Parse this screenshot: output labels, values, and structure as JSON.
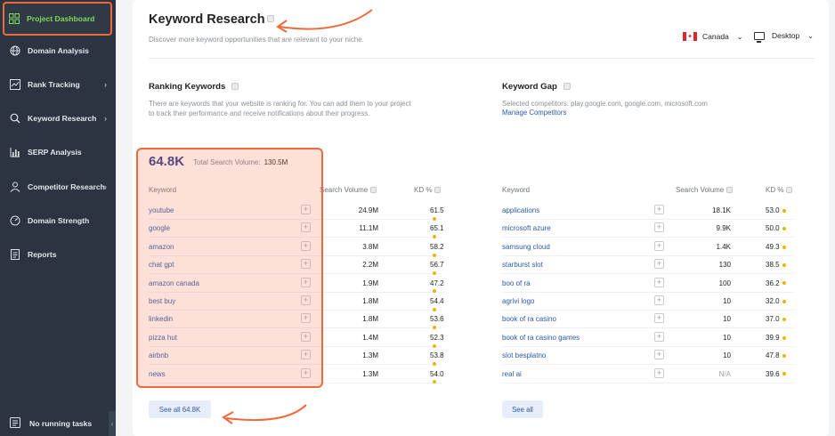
{
  "sidebar": {
    "items": [
      {
        "label": "Project Dashboard",
        "icon": "grid-icon",
        "chevron": ""
      },
      {
        "label": "Domain Analysis",
        "icon": "globe-icon",
        "chevron": ""
      },
      {
        "label": "Rank Tracking",
        "icon": "chart-box-icon",
        "chevron": "›"
      },
      {
        "label": "Keyword Research",
        "icon": "search-icon",
        "chevron": "›"
      },
      {
        "label": "SERP Analysis",
        "icon": "bar-chart-icon",
        "chevron": ""
      },
      {
        "label": "Competitor Research",
        "icon": "user-icon",
        "chevron": "›"
      },
      {
        "label": "Domain Strength",
        "icon": "gauge-icon",
        "chevron": ""
      },
      {
        "label": "Reports",
        "icon": "document-icon",
        "chevron": ""
      }
    ],
    "bottom_label": "No running tasks",
    "collapse_glyph": "‹"
  },
  "header": {
    "title": "Keyword Research",
    "subtitle": "Discover more keyword opportunities that are relevant to your niche.",
    "country": "Canada",
    "device": "Desktop",
    "caret": "⌄"
  },
  "ranking": {
    "title": "Ranking Keywords",
    "description_line1": "There are keywords that your website is ranking for. You can add them to your project",
    "description_line2": "to track their performance and receive notifications about their progress.",
    "total": "64.8K",
    "volume_label": "Total Search Volume:",
    "volume_value": "130.5M",
    "columns": {
      "keyword": "Keyword",
      "volume": "Search Volume",
      "kd": "KD %"
    },
    "rows": [
      {
        "keyword": "youtube",
        "volume": "24.9M",
        "kd": "61.5"
      },
      {
        "keyword": "google",
        "volume": "11.1M",
        "kd": "65.1"
      },
      {
        "keyword": "amazon",
        "volume": "3.8M",
        "kd": "58.2"
      },
      {
        "keyword": "chat gpt",
        "volume": "2.2M",
        "kd": "56.7"
      },
      {
        "keyword": "amazon canada",
        "volume": "1.9M",
        "kd": "47.2"
      },
      {
        "keyword": "best buy",
        "volume": "1.8M",
        "kd": "54.4"
      },
      {
        "keyword": "linkedin",
        "volume": "1.8M",
        "kd": "53.6"
      },
      {
        "keyword": "pizza hut",
        "volume": "1.4M",
        "kd": "52.3"
      },
      {
        "keyword": "airbnb",
        "volume": "1.3M",
        "kd": "53.8"
      },
      {
        "keyword": "news",
        "volume": "1.3M",
        "kd": "54.0"
      }
    ],
    "see_all": "See all 64.8K"
  },
  "gap": {
    "title": "Keyword Gap",
    "description": "Selected competitors: play.google.com, google.com, microsoft.com",
    "manage_link": "Manage Competitors",
    "columns": {
      "keyword": "Keyword",
      "volume": "Search Volume",
      "kd": "KD %"
    },
    "rows": [
      {
        "keyword": "applications",
        "volume": "18.1K",
        "kd": "53.0"
      },
      {
        "keyword": "microsoft azure",
        "volume": "9.9K",
        "kd": "50.0"
      },
      {
        "keyword": "samsung cloud",
        "volume": "1.4K",
        "kd": "49.3"
      },
      {
        "keyword": "starburst slot",
        "volume": "130",
        "kd": "38.5"
      },
      {
        "keyword": "boo of ra",
        "volume": "100",
        "kd": "36.2"
      },
      {
        "keyword": "agrivi logo",
        "volume": "10",
        "kd": "32.0"
      },
      {
        "keyword": "book of ra casino",
        "volume": "10",
        "kd": "37.0"
      },
      {
        "keyword": "book of ra casino games",
        "volume": "10",
        "kd": "39.9"
      },
      {
        "keyword": "slot besplatno",
        "volume": "10",
        "kd": "47.8"
      },
      {
        "keyword": "real ai",
        "volume": "N/A",
        "kd": "39.6"
      }
    ],
    "see_all": "See all"
  },
  "plus_glyph": "+",
  "colors": {
    "accent": "#ef6a3a",
    "link": "#2c5aa8",
    "kd_dot": "#f0b400",
    "sidebar_bg": "#2b3440",
    "active_text": "#7ed957"
  }
}
